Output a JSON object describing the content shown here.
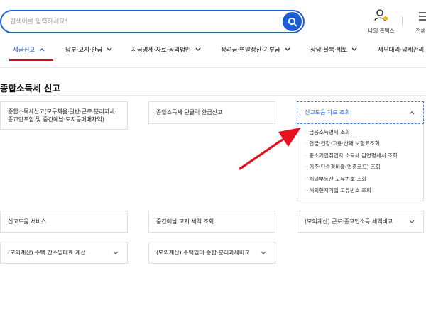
{
  "search": {
    "placeholder": "검색어를 입력하세요!"
  },
  "utility": {
    "my_home": "나의 홈택스",
    "all_menu": "전체메"
  },
  "gnb": {
    "items": [
      {
        "label": "세금신고"
      },
      {
        "label": "납부·고지·환급"
      },
      {
        "label": "지급명세·자료·공익법인"
      },
      {
        "label": "장려금·연말정산·기부금"
      },
      {
        "label": "상담·불복·제보"
      },
      {
        "label": "세무대리·납세관리"
      }
    ]
  },
  "page": {
    "title": "종합소득세 신고"
  },
  "cards": {
    "c1": "종합소득세신고(모두채움·일반·근로·분리과세·종교인포함 및 중간예납·토지등매매차익)",
    "c2": "종합소득세 원클릭 환급신고",
    "c3": "신고도움 자료 조회",
    "c4": "신고도움 서비스",
    "c5": "중간예납 고지 세액 조회",
    "c6": "(모의계산) 근로·종교인소득 세액비교",
    "c7": "(모의계산) 주택 간주임대료 계산",
    "c8": "(모의계산) 주택임대 종합·분리과세비교"
  },
  "submenu": {
    "items": [
      "금융소득명세 조회",
      "연금·건강·고용·산재 보험료조회",
      "중소기업취업자 소득세 감면명세서 조회",
      "기준·단순경비율(업종코드) 조회",
      "해외부동산 고유번호 조회",
      "해외현지기업 고유번호 조회"
    ]
  },
  "colors": {
    "brand_blue": "#1a5fd6",
    "active_underline": "#e0001f",
    "annotation_arrow": "#e8111f"
  },
  "icons": [
    "search-icon",
    "user-bell-icon",
    "hamburger-icon",
    "chevron-up-icon",
    "chevron-down-icon"
  ]
}
